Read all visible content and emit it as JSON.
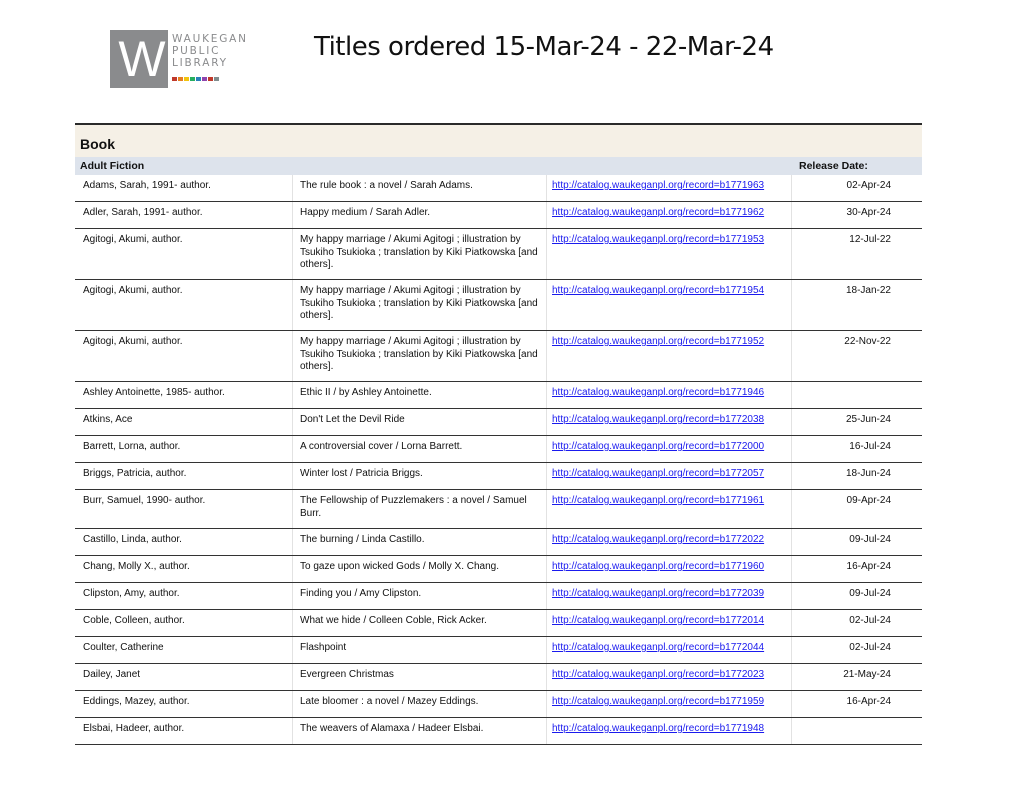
{
  "logo": {
    "letter": "W",
    "lines": [
      "WAUKEGAN",
      "PUBLIC",
      "LIBRARY"
    ],
    "bar_colors": [
      "#c0392b",
      "#e67e22",
      "#f1c40f",
      "#27ae60",
      "#2980b9",
      "#8e44ad",
      "#c0392b",
      "#7f8c8d"
    ]
  },
  "title": "Titles ordered 15-Mar-24 - 22-Mar-24",
  "category": "Book",
  "subcategory": "Adult Fiction",
  "release_header": "Release Date:",
  "rows": [
    {
      "author": "Adams, Sarah, 1991- author.",
      "title": "The rule book : a novel / Sarah Adams.",
      "url": "http://catalog.waukeganpl.org/record=b1771963",
      "date": "02-Apr-24",
      "h": 27
    },
    {
      "author": "Adler, Sarah, 1991- author.",
      "title": "Happy medium / Sarah Adler.",
      "url": "http://catalog.waukeganpl.org/record=b1771962",
      "date": "30-Apr-24",
      "h": 27
    },
    {
      "author": "Agitogi, Akumi, author.",
      "title": "My happy marriage / Akumi Agitogi ; illustration by Tsukiho Tsukioka ; translation by Kiki Piatkowska [and others].",
      "url": "http://catalog.waukeganpl.org/record=b1771953",
      "date": "12-Jul-22",
      "h": 51
    },
    {
      "author": "Agitogi, Akumi, author.",
      "title": "My happy marriage / Akumi Agitogi ; illustration by Tsukiho Tsukioka ; translation by Kiki Piatkowska [and others].",
      "url": "http://catalog.waukeganpl.org/record=b1771954",
      "date": "18-Jan-22",
      "h": 51
    },
    {
      "author": "Agitogi, Akumi, author.",
      "title": "My happy marriage / Akumi Agitogi ; illustration by Tsukiho Tsukioka ; translation by Kiki Piatkowska [and others].",
      "url": "http://catalog.waukeganpl.org/record=b1771952",
      "date": "22-Nov-22",
      "h": 51
    },
    {
      "author": "Ashley Antoinette, 1985- author.",
      "title": "Ethic II / by Ashley Antoinette.",
      "url": "http://catalog.waukeganpl.org/record=b1771946",
      "date": "",
      "h": 27
    },
    {
      "author": "Atkins, Ace",
      "title": "Don't Let the Devil Ride",
      "url": "http://catalog.waukeganpl.org/record=b1772038",
      "date": "25-Jun-24",
      "h": 27
    },
    {
      "author": "Barrett, Lorna, author.",
      "title": "A controversial cover / Lorna Barrett.",
      "url": "http://catalog.waukeganpl.org/record=b1772000",
      "date": "16-Jul-24",
      "h": 27
    },
    {
      "author": "Briggs, Patricia, author.",
      "title": "Winter lost / Patricia Briggs.",
      "url": "http://catalog.waukeganpl.org/record=b1772057",
      "date": "18-Jun-24",
      "h": 27
    },
    {
      "author": "Burr, Samuel, 1990- author.",
      "title": "The Fellowship of Puzzlemakers : a novel / Samuel Burr.",
      "url": "http://catalog.waukeganpl.org/record=b1771961",
      "date": "09-Apr-24",
      "h": 39
    },
    {
      "author": "Castillo, Linda, author.",
      "title": "The burning / Linda Castillo.",
      "url": "http://catalog.waukeganpl.org/record=b1772022",
      "date": "09-Jul-24",
      "h": 27
    },
    {
      "author": "Chang, Molly X., author.",
      "title": "To gaze upon wicked Gods / Molly X. Chang.",
      "url": "http://catalog.waukeganpl.org/record=b1771960",
      "date": "16-Apr-24",
      "h": 27
    },
    {
      "author": "Clipston, Amy, author.",
      "title": "Finding you / Amy Clipston.",
      "url": "http://catalog.waukeganpl.org/record=b1772039",
      "date": "09-Jul-24",
      "h": 27
    },
    {
      "author": "Coble, Colleen, author.",
      "title": "What we hide / Colleen Coble, Rick Acker.",
      "url": "http://catalog.waukeganpl.org/record=b1772014",
      "date": "02-Jul-24",
      "h": 27
    },
    {
      "author": "Coulter, Catherine",
      "title": "Flashpoint",
      "url": "http://catalog.waukeganpl.org/record=b1772044",
      "date": "02-Jul-24",
      "h": 27
    },
    {
      "author": "Dailey, Janet",
      "title": "Evergreen Christmas",
      "url": "http://catalog.waukeganpl.org/record=b1772023",
      "date": "21-May-24",
      "h": 27
    },
    {
      "author": "Eddings, Mazey, author.",
      "title": "Late bloomer : a novel / Mazey Eddings.",
      "url": "http://catalog.waukeganpl.org/record=b1771959",
      "date": "16-Apr-24",
      "h": 27
    },
    {
      "author": "Elsbai, Hadeer, author.",
      "title": "The weavers of Alamaxa / Hadeer Elsbai.",
      "url": "http://catalog.waukeganpl.org/record=b1771948",
      "date": "",
      "h": 27
    }
  ]
}
